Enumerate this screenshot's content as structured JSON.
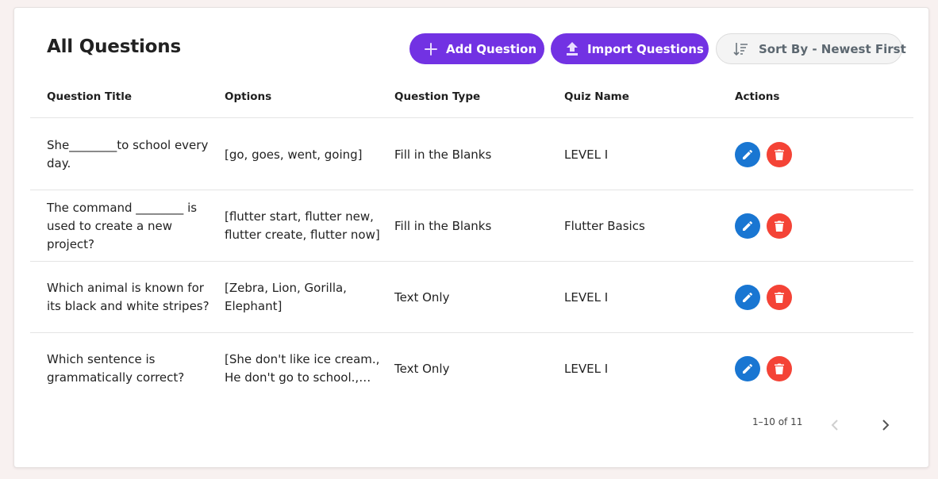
{
  "page": {
    "title": "All Questions"
  },
  "toolbar": {
    "add_label": "Add Question",
    "import_label": "Import Questions",
    "sort_label": "Sort By - Newest First"
  },
  "table": {
    "columns": [
      "Question Title",
      "Options",
      "Question Type",
      "Quiz Name",
      "Actions"
    ],
    "rows": [
      {
        "title": "She________to school every day.",
        "options": "[go, goes, went, going]",
        "type": "Fill in the Blanks",
        "quiz": "LEVEL I"
      },
      {
        "title": "The command ________ is used to create a new project?",
        "options": "[flutter start, flutter new, flutter create, flutter now]",
        "type": "Fill in the Blanks",
        "quiz": "Flutter Basics"
      },
      {
        "title": "Which animal is known for its black and white stripes?",
        "options": "[Zebra, Lion, Gorilla, Elephant]",
        "type": "Text Only",
        "quiz": "LEVEL I"
      },
      {
        "title": "Which sentence is grammatically correct?",
        "options": "[She don't like ice cream., He don't go to school., They doesn't play football., She doesn't like ice cream.]",
        "type": "Text Only",
        "quiz": "LEVEL I"
      }
    ]
  },
  "pagination": {
    "range_text": "1–10 of 11"
  },
  "icons": {
    "add": "plus-icon",
    "import": "upload-icon",
    "sort": "sort-icon",
    "edit": "pencil-icon",
    "delete": "trash-icon",
    "prev": "chevron-left-icon",
    "next": "chevron-right-icon"
  },
  "colors": {
    "primary": "#7232e3",
    "edit": "#1976d2",
    "delete": "#f44336",
    "background": "#f8f1f0"
  }
}
